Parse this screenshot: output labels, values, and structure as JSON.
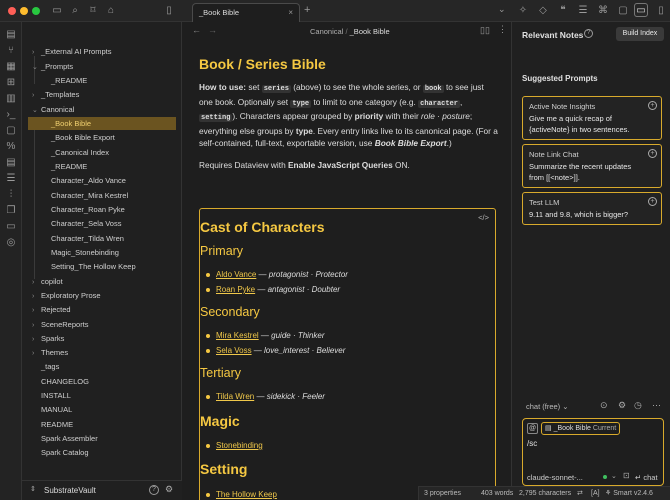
{
  "topbar": {
    "tab_title": "_Book Bible",
    "new_tab": "+"
  },
  "explorer": {
    "items": [
      {
        "label": "_External AI Prompts",
        "chev": "›"
      },
      {
        "label": "_Prompts",
        "chev": "⌄"
      },
      {
        "label": "_README",
        "chev": ""
      },
      {
        "label": "_Templates",
        "chev": "›"
      },
      {
        "label": "Canonical",
        "chev": "⌄"
      },
      {
        "label": "_Book Bible",
        "chev": ""
      },
      {
        "label": "_Book Bible Export",
        "chev": ""
      },
      {
        "label": "_Canonical Index",
        "chev": ""
      },
      {
        "label": "_README",
        "chev": ""
      },
      {
        "label": "Character_Aldo Vance",
        "chev": ""
      },
      {
        "label": "Character_Mira Kestrel",
        "chev": ""
      },
      {
        "label": "Character_Roan Pyke",
        "chev": ""
      },
      {
        "label": "Character_Sela Voss",
        "chev": ""
      },
      {
        "label": "Character_Tilda Wren",
        "chev": ""
      },
      {
        "label": "Magic_Stonebinding",
        "chev": ""
      },
      {
        "label": "Setting_The Hollow Keep",
        "chev": ""
      },
      {
        "label": "copilot",
        "chev": "›"
      },
      {
        "label": "Exploratory Prose",
        "chev": "›"
      },
      {
        "label": "Rejected",
        "chev": "›"
      },
      {
        "label": "SceneReports",
        "chev": "›"
      },
      {
        "label": "Sparks",
        "chev": "›"
      },
      {
        "label": "Themes",
        "chev": "›"
      },
      {
        "label": "_tags",
        "chev": ""
      },
      {
        "label": "CHANGELOG",
        "chev": ""
      },
      {
        "label": "INSTALL",
        "chev": ""
      },
      {
        "label": "MANUAL",
        "chev": ""
      },
      {
        "label": "README",
        "chev": ""
      },
      {
        "label": "Spark Assembler",
        "chev": ""
      },
      {
        "label": "Spark Catalog",
        "chev": ""
      }
    ],
    "vault_name": "SubstrateVault"
  },
  "editor": {
    "breadcrumb_parent": "Canonical",
    "breadcrumb_sep": "/",
    "breadcrumb_current": "_Book Bible",
    "title": "Book / Series Bible",
    "p1": {
      "howto": "How to use:",
      "t1": " set ",
      "c1": "series",
      "t2": " (above) to see the whole series, or ",
      "c2": "book",
      "t3": " to see just one book. Optionally set ",
      "c3": "type",
      "t4": " to limit to one category (e.g. ",
      "c4": "character",
      "t5": ", ",
      "c5": "setting",
      "t6": "). Characters appear grouped by ",
      "b1": "priority",
      "t7": " with their ",
      "i1": "role · posture",
      "t8": "; everything else groups by ",
      "b2": "type",
      "t9": ". Every entry links live to its canonical page. (For a self-contained, full-text, exportable version, use ",
      "bi": "Book Bible Export",
      "t10": ".)"
    },
    "p2": {
      "t1": "Requires Dataview with ",
      "b1": "Enable JavaScript Queries",
      "t2": " ON."
    },
    "dv": {
      "code_icon": "</>",
      "h_cast": "Cast of Characters",
      "h_primary": "Primary",
      "primary": [
        {
          "name": "Aldo Vance",
          "sep": " — ",
          "desc": "protagonist · Protector"
        },
        {
          "name": "Roan Pyke",
          "sep": " — ",
          "desc": "antagonist · Doubter"
        }
      ],
      "h_secondary": "Secondary",
      "secondary": [
        {
          "name": "Mira Kestrel",
          "sep": " — ",
          "desc": "guide · Thinker"
        },
        {
          "name": "Sela Voss",
          "sep": " — ",
          "desc": "love_interest · Believer"
        }
      ],
      "h_tertiary": "Tertiary",
      "tertiary": [
        {
          "name": "Tilda Wren",
          "sep": " — ",
          "desc": "sidekick · Feeler"
        }
      ],
      "h_magic": "Magic",
      "magic": [
        "Stonebinding"
      ],
      "h_setting": "Setting",
      "setting": [
        "The Hollow Keep"
      ]
    }
  },
  "rpanel": {
    "title": "Relevant Notes",
    "build_index": "Build Index",
    "suggested": "Suggested Prompts",
    "cards": [
      {
        "title": "Active Note Insights",
        "line1": "Give me a quick recap of",
        "line2": "{activeNote} in two sentences."
      },
      {
        "title": "Note Link Chat",
        "line1": "Summarize the recent updates",
        "line2": "from [[<note>]]."
      },
      {
        "title": "Test LLM",
        "line1": "9.11 and 9.8, which is bigger?",
        "line2": ""
      }
    ],
    "chat_mode": "chat (free)",
    "context_at": "@",
    "context_note": "_Book Bible",
    "context_tag": "Current",
    "input_text": "/sc",
    "model": "claude-sonnet-...",
    "send_label": "chat"
  },
  "status": {
    "properties": "3 properties",
    "words": "403 words",
    "chars": "2,795 characters",
    "mode": "[A]",
    "plugin": "Smart v2.4.6"
  },
  "colors": {
    "accent": "#f5c842",
    "active_bg": "#6b5420",
    "border_accent": "#d8aa2c"
  }
}
